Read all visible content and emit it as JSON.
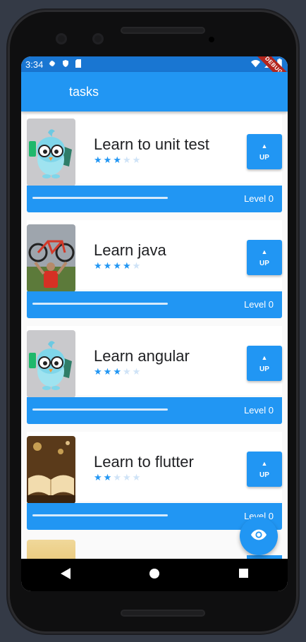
{
  "status_bar": {
    "time": "3:34",
    "debug_label": "DEBUG",
    "icons": [
      "gear-icon",
      "shield-icon",
      "sd-card-icon",
      "wifi-icon",
      "signal-icon",
      "battery-icon"
    ]
  },
  "app_bar": {
    "title": "tasks"
  },
  "tasks": [
    {
      "title": "Learn to unit test",
      "stars": 3,
      "max_stars": 5,
      "up_label": "UP",
      "level_label": "Level 0",
      "progress": 0.0,
      "image": "bird-mascot"
    },
    {
      "title": "Learn java",
      "stars": 4,
      "max_stars": 5,
      "up_label": "UP",
      "level_label": "Level 0",
      "progress": 0.0,
      "image": "bicycle-photo"
    },
    {
      "title": "Learn angular",
      "stars": 3,
      "max_stars": 5,
      "up_label": "UP",
      "level_label": "Level 0",
      "progress": 0.0,
      "image": "bird-mascot"
    },
    {
      "title": "Learn to flutter",
      "stars": 2,
      "max_stars": 5,
      "up_label": "UP",
      "level_label": "Level 0",
      "progress": 0.0,
      "image": "book-photo"
    }
  ],
  "fab": {
    "icon": "eye-icon"
  },
  "nav_bar": {
    "icons": [
      "back-icon",
      "home-icon",
      "recents-icon"
    ]
  },
  "colors": {
    "primary": "#2196f3",
    "status_bar": "#1976d2",
    "star_off": "#cfe3f7",
    "background": "#fafafa"
  }
}
